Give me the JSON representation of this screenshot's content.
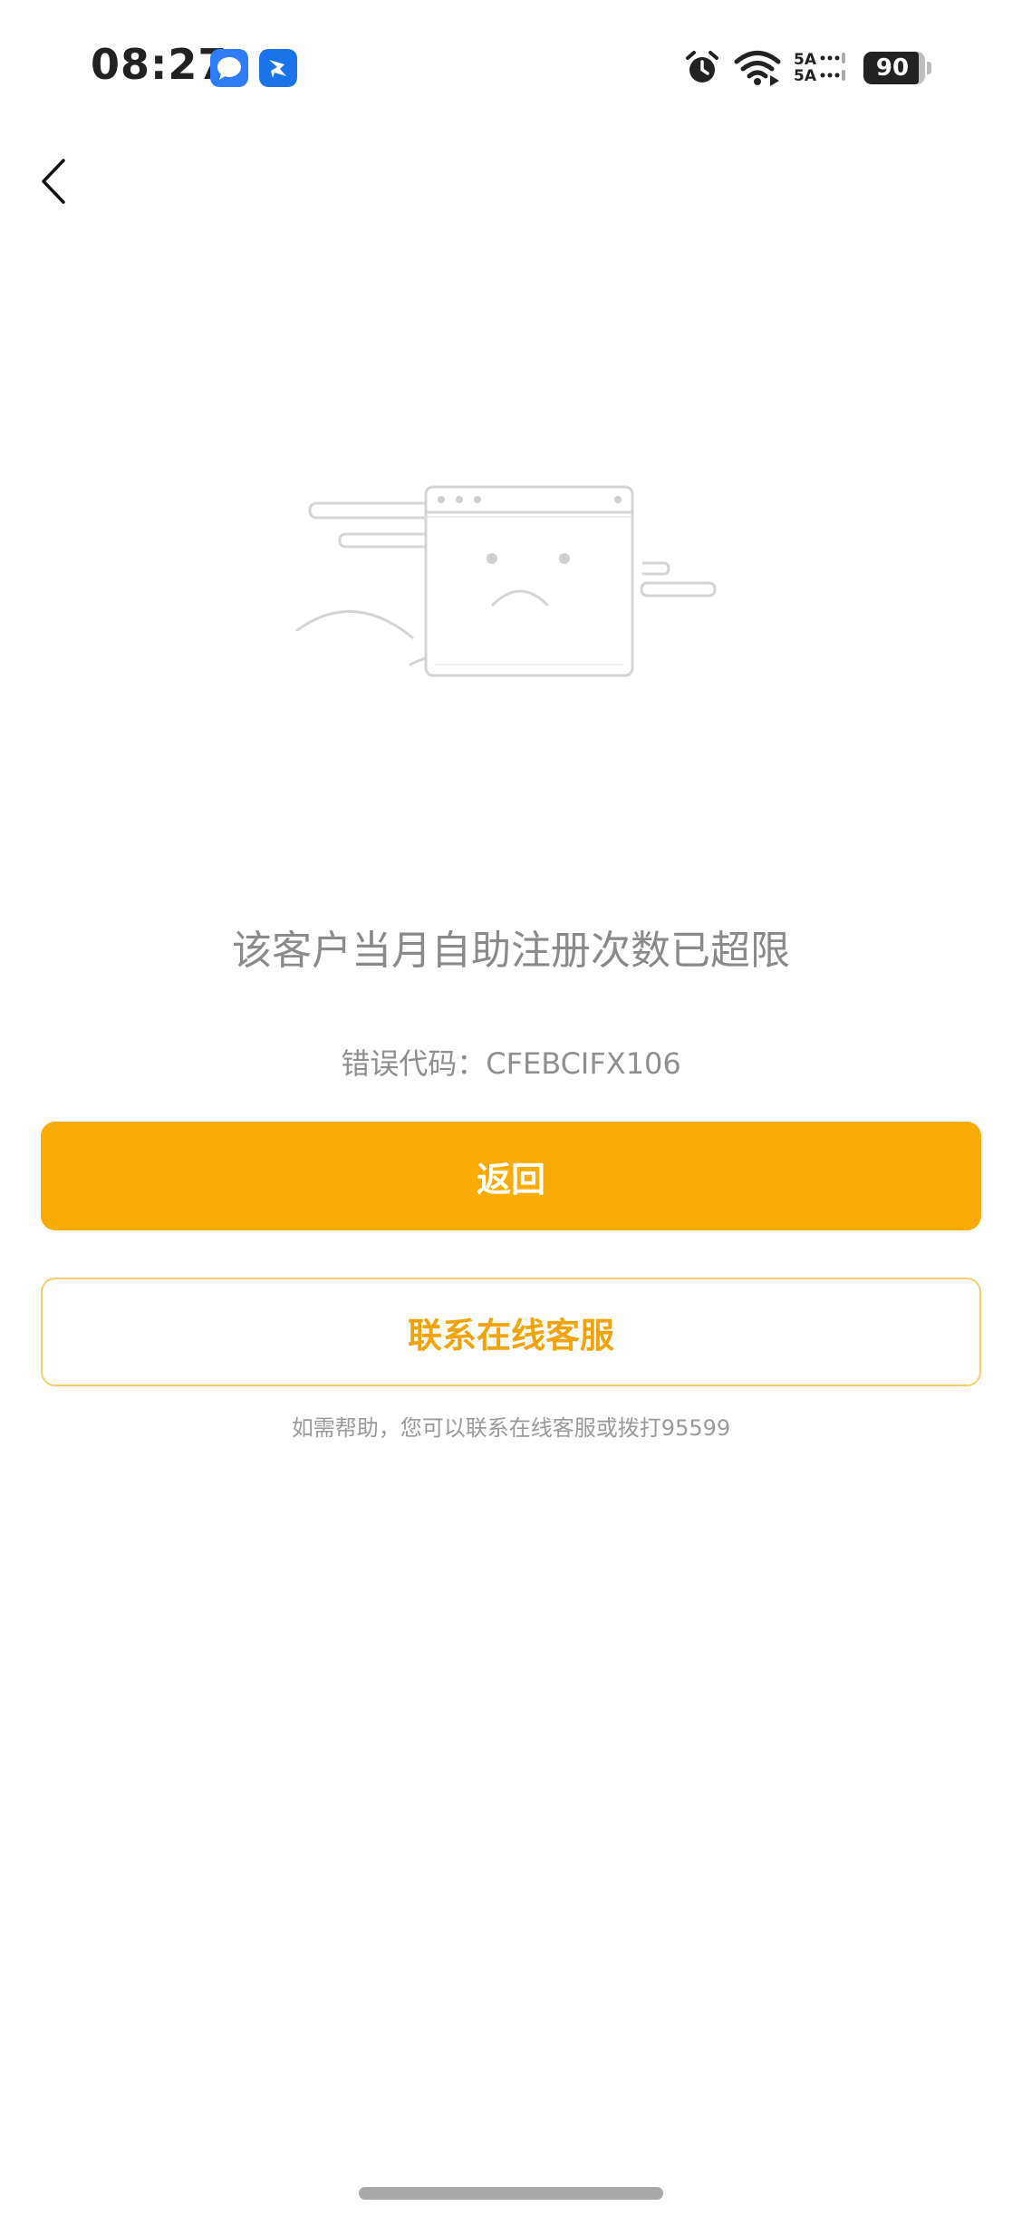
{
  "status_bar": {
    "time": "08:27",
    "network_line1": "5A",
    "network_line2": "5A",
    "battery_level": 90,
    "battery_text": "90",
    "icons": [
      "message-app-icon",
      "feishu-app-icon",
      "alarm-icon",
      "wifi-icon",
      "cellular-signal-icon",
      "battery-icon"
    ]
  },
  "nav": {
    "back_icon": "chevron-left-icon"
  },
  "illustration": {
    "icon": "sad-browser-window-illustration"
  },
  "error": {
    "title": "该客户当月自助注册次数已超限",
    "code_text": "错误代码：CFEBCIFX106"
  },
  "actions": {
    "primary_label": "返回",
    "secondary_label": "联系在线客服"
  },
  "help": {
    "text": "如需帮助，您可以联系在线客服或拨打95599"
  },
  "colors": {
    "accent": "#f9ab07",
    "accent_text": "#f0a40a",
    "accent_border": "#f3cf6e",
    "title_gray": "#8a8a8a"
  }
}
